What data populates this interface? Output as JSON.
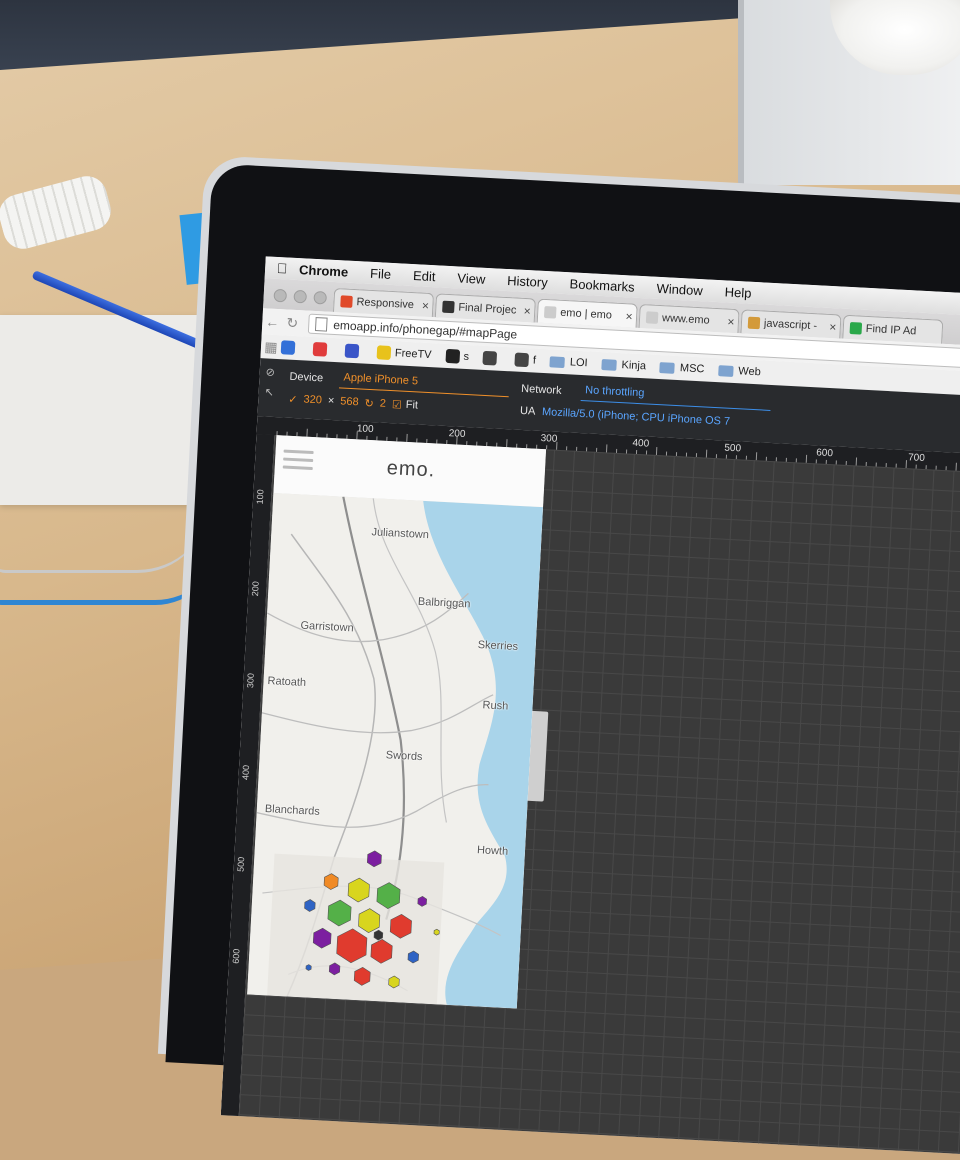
{
  "menubar": {
    "apple": "",
    "items": [
      "Chrome",
      "File",
      "Edit",
      "View",
      "History",
      "Bookmarks",
      "Window",
      "Help"
    ]
  },
  "tabs": [
    {
      "title": "Responsive",
      "close": "×",
      "favicon_color": "#e04a2a"
    },
    {
      "title": "Final Projec",
      "close": "×",
      "favicon_color": "#333333"
    },
    {
      "title": "emo | emo",
      "close": "×",
      "favicon_color": "#cccccc"
    },
    {
      "title": "www.emo",
      "close": "×",
      "favicon_color": "#cccccc"
    },
    {
      "title": "javascript -",
      "close": "×",
      "favicon_color": "#d39a3a"
    },
    {
      "title": "Find IP Ad",
      "close": "",
      "favicon_color": "#2aa84a"
    }
  ],
  "url": "emoapp.info/phonegap/#mapPage",
  "bookmarks": [
    {
      "label": "",
      "color": "#3370d8"
    },
    {
      "label": "",
      "color": "#e03c3c"
    },
    {
      "label": "",
      "color": "#3a55c8"
    },
    {
      "label": "FreeTV",
      "color": "#e8c21c"
    },
    {
      "label": "s",
      "color": "#222222"
    },
    {
      "label": "",
      "color": "#444444"
    },
    {
      "label": "f",
      "color": "#444444"
    }
  ],
  "bookmark_folders": [
    "LOI",
    "Kinja",
    "MSC",
    "Web"
  ],
  "devtools": {
    "device_label": "Device",
    "device_value": "Apple iPhone 5",
    "width": "320",
    "height": "568",
    "dpr": "2",
    "fit_label": "Fit",
    "times": "×",
    "network_label": "Network",
    "network_value": "No throttling",
    "ua_label": "UA",
    "ua_value": "Mozilla/5.0 (iPhone; CPU iPhone OS 7"
  },
  "ruler": {
    "ticks": [
      "100",
      "200",
      "300",
      "400",
      "500",
      "600",
      "700"
    ],
    "vticks": [
      "100",
      "200",
      "300",
      "400",
      "500",
      "600"
    ]
  },
  "app": {
    "title": "emo."
  },
  "map": {
    "places": [
      "Julianstown",
      "Balbriggan",
      "Skerries",
      "Garristown",
      "Rush",
      "Swords",
      "Blanchards",
      "Howth",
      "Ratoath"
    ],
    "emotion_colors": {
      "happy": "#d8d51e",
      "calm": "#54b048",
      "angry": "#e03b2e",
      "excited": "#f08a25",
      "sad": "#7c1fa0",
      "lonely": "#2e63c4"
    }
  }
}
